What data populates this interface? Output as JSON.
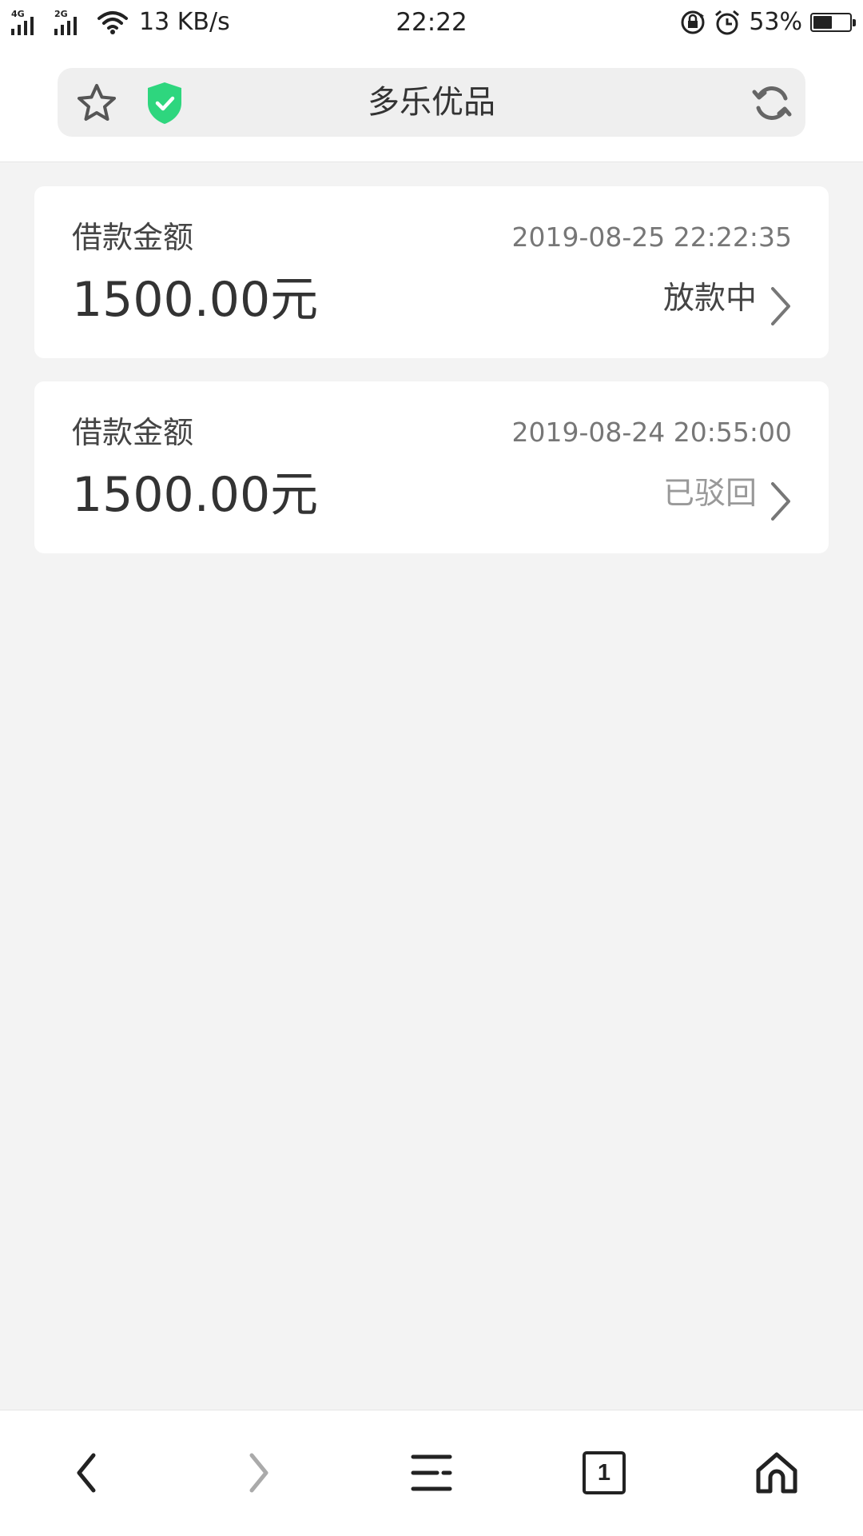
{
  "status_bar": {
    "network_1": "4G",
    "network_2": "2G",
    "net_speed": "13 KB/s",
    "time": "22:22",
    "battery_percent_text": "53%",
    "battery_level": 0.53
  },
  "address_bar": {
    "title": "多乐优品",
    "shield_color": "#2ed67e"
  },
  "loans": [
    {
      "label": "借款金额",
      "date": "2019-08-25 22:22:35",
      "amount": "1500.00元",
      "status": "放款中",
      "status_color": "#444444"
    },
    {
      "label": "借款金额",
      "date": "2019-08-24 20:55:00",
      "amount": "1500.00元",
      "status": "已驳回",
      "status_color": "#999999"
    }
  ],
  "bottom_nav": {
    "tab_count": "1",
    "items": [
      "back-icon",
      "forward-icon",
      "menu-icon",
      "tabs-icon",
      "home-icon"
    ]
  }
}
